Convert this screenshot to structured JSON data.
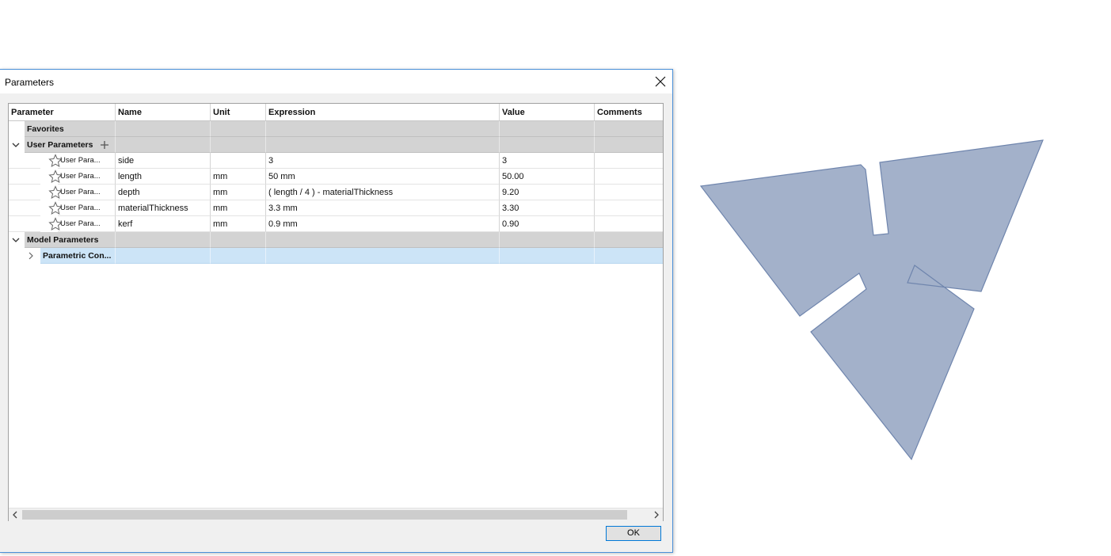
{
  "dialog": {
    "title": "Parameters",
    "ok_label": "OK"
  },
  "table": {
    "columns": [
      "Parameter",
      "Name",
      "Unit",
      "Expression",
      "Value",
      "Comments"
    ],
    "groups": {
      "favorites": "Favorites",
      "user": "User Parameters",
      "model": "Model Parameters"
    },
    "user_rows": [
      {
        "parameter": "User Para...",
        "name": "side",
        "unit": "",
        "expression": "3",
        "value": "3",
        "comments": ""
      },
      {
        "parameter": "User Para...",
        "name": "length",
        "unit": "mm",
        "expression": "50 mm",
        "value": "50.00",
        "comments": ""
      },
      {
        "parameter": "User Para...",
        "name": "depth",
        "unit": "mm",
        "expression": "( length / 4 ) - materialThickness",
        "value": "9.20",
        "comments": ""
      },
      {
        "parameter": "User Para...",
        "name": "materialThickness",
        "unit": "mm",
        "expression": "3.3 mm",
        "value": "3.30",
        "comments": ""
      },
      {
        "parameter": "User Para...",
        "name": "kerf",
        "unit": "mm",
        "expression": "0.9 mm",
        "value": "0.90",
        "comments": ""
      }
    ],
    "model_child": "Parametric Con..."
  },
  "colors": {
    "shape_fill": "#a3b1ca",
    "shape_stroke": "#6f85ad",
    "selection": "#cce4f7",
    "accent": "#0078d7"
  },
  "icons": [
    "close-icon",
    "add-icon",
    "star-icon",
    "chevron-down-icon",
    "chevron-right-icon",
    "chevron-left-icon"
  ]
}
